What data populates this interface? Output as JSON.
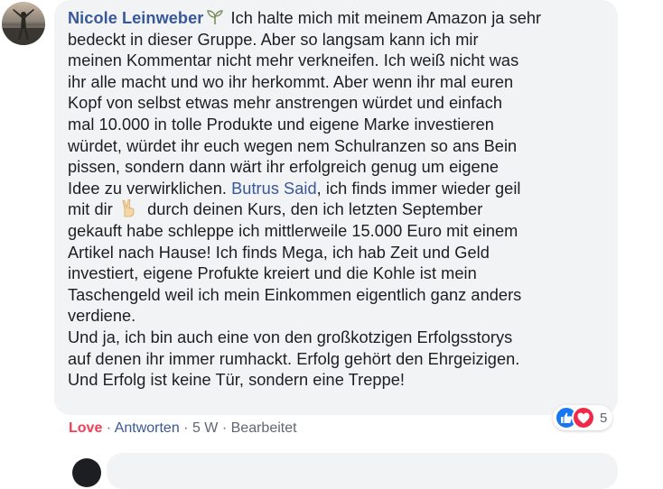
{
  "comment": {
    "author": "Nicole Leinweber",
    "text_1": " Ich halte mich mit meinem Amazon ja sehr",
    "lines_a": [
      "bedeckt in dieser Gruppe. Aber so langsam kann ich mir",
      "meinen Kommentar nicht mehr verkneifen. Ich weiß nicht was",
      "ihr alle macht und wo ihr herkommt. Aber wenn ihr mal euren",
      "Kopf von selbst etwas mehr anstrengen würdet und einfach",
      "mal 10.000 in tolle Produkte und eigene Marke investieren",
      "würdet, würdet ihr euch wegen nem Schulranzen so ans Bein",
      "pissen, sondern dann wärt ihr erfolgreich genug um eigene"
    ],
    "line_mention_before": "Idee zu verwirklichen. ",
    "mention": "Butrus Said",
    "line_mention_after": ", ich finds immer wieder geil",
    "line_emoji_before": "mit dir ",
    "line_emoji_after": " durch deinen Kurs, den ich letzten September",
    "lines_b": [
      "gekauft habe schleppe ich mittlerweile 15.000 Euro mit einem",
      "Artikel nach Hause! Ich finds Mega, ich hab Zeit und Geld",
      "investiert, eigene Profukte kreiert und die Kohle ist mein",
      "Taschengeld weil ich mein Einkommen eigentlich ganz anders",
      "verdiene.",
      "Und ja, ich bin auch eine von den großkotzigen Erfolgsstorys",
      "auf denen ihr immer rumhackt. Erfolg gehört den Ehrgeizigen.",
      "Und Erfolg ist keine Tür, sondern eine Treppe!"
    ]
  },
  "reactions": {
    "count": "5",
    "icons": [
      "like-icon",
      "love-icon"
    ],
    "like_color": "#1877f2",
    "love_color": "#f0284a"
  },
  "actions": {
    "love": "Love",
    "sep_1": " · ",
    "reply": "Antworten",
    "sep_2": " · ",
    "time": "5 W",
    "sep_3": " · ",
    "edited": "Bearbeitet"
  },
  "colors": {
    "link": "#385898",
    "love": "#f33e58",
    "bubble": "#f2f3f5",
    "text": "#1c1e21",
    "meta": "#606770"
  }
}
